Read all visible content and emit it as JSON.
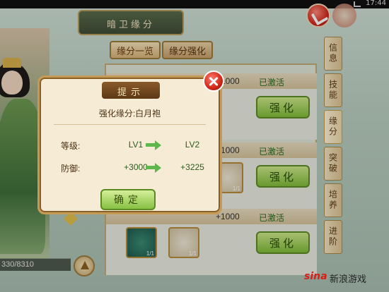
{
  "status_bar": {
    "time": "17:44"
  },
  "header": {
    "title": "暗卫缘分"
  },
  "tabs": [
    {
      "label": "缘分一览"
    },
    {
      "label": "缘分强化"
    }
  ],
  "side_tabs": [
    {
      "label": "信息"
    },
    {
      "label": "技能"
    },
    {
      "label": "缘分"
    },
    {
      "label": "突破"
    },
    {
      "label": "培养"
    },
    {
      "label": "进阶"
    }
  ],
  "rows": [
    {
      "value": "+1000",
      "status": "已激活",
      "button": "强化"
    },
    {
      "value": "+1000",
      "status": "已激活",
      "button": "强化"
    },
    {
      "value": "+1000",
      "status": "已激活",
      "button": "强化"
    }
  ],
  "item_counts": {
    "shell_top": "1/1",
    "jade_bottom": "1/1",
    "shell_bottom": "1/1"
  },
  "bottom": {
    "exp_text": "330/8310"
  },
  "modal": {
    "title": "提示",
    "subtitle": "强化缘分:白月袍",
    "stats": [
      {
        "label": "等级:",
        "from": "LV1",
        "to": "LV2"
      },
      {
        "label": "防御:",
        "from": "+3000",
        "to": "+3225"
      }
    ],
    "confirm": "确定"
  },
  "watermark": {
    "logo": "sina",
    "text": "新浪游戏"
  }
}
